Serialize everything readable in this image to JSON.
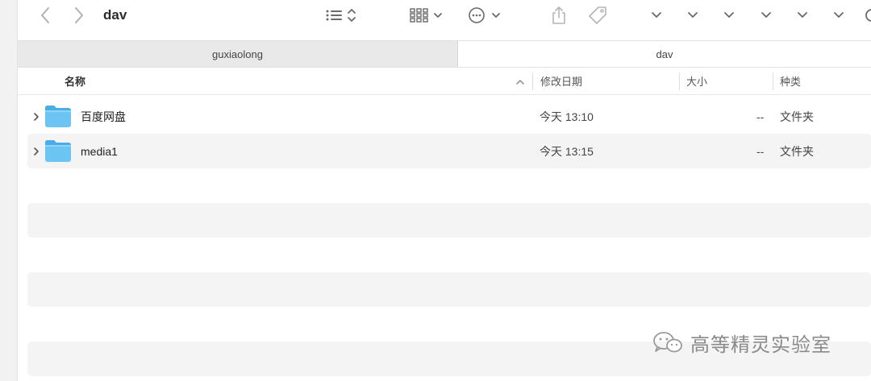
{
  "window": {
    "title": "dav"
  },
  "toolbar": {
    "back_icon": "chevron-left-icon",
    "forward_icon": "chevron-right-icon",
    "view_list_icon": "list-view-icon",
    "view_grid_icon": "grid-view-icon",
    "more_icon": "ellipsis-circle-icon",
    "share_icon": "share-icon",
    "tag_icon": "tag-icon",
    "chevron_count": 6,
    "search_icon": "search-icon"
  },
  "tabs": [
    {
      "label": "guxiaolong",
      "active": false
    },
    {
      "label": "dav",
      "active": true
    }
  ],
  "columns": {
    "name": "名称",
    "date": "修改日期",
    "size": "大小",
    "kind": "种类"
  },
  "files": [
    {
      "name": "百度网盘",
      "date": "今天 13:10",
      "size": "--",
      "kind": "文件夹"
    },
    {
      "name": "media1",
      "date": "今天 13:15",
      "size": "--",
      "kind": "文件夹"
    }
  ],
  "watermark": {
    "text": "高等精灵实验室"
  },
  "colors": {
    "folder": "#6cc4f3",
    "folder_dark": "#4aaee6",
    "stripe": "#f4f4f5"
  }
}
